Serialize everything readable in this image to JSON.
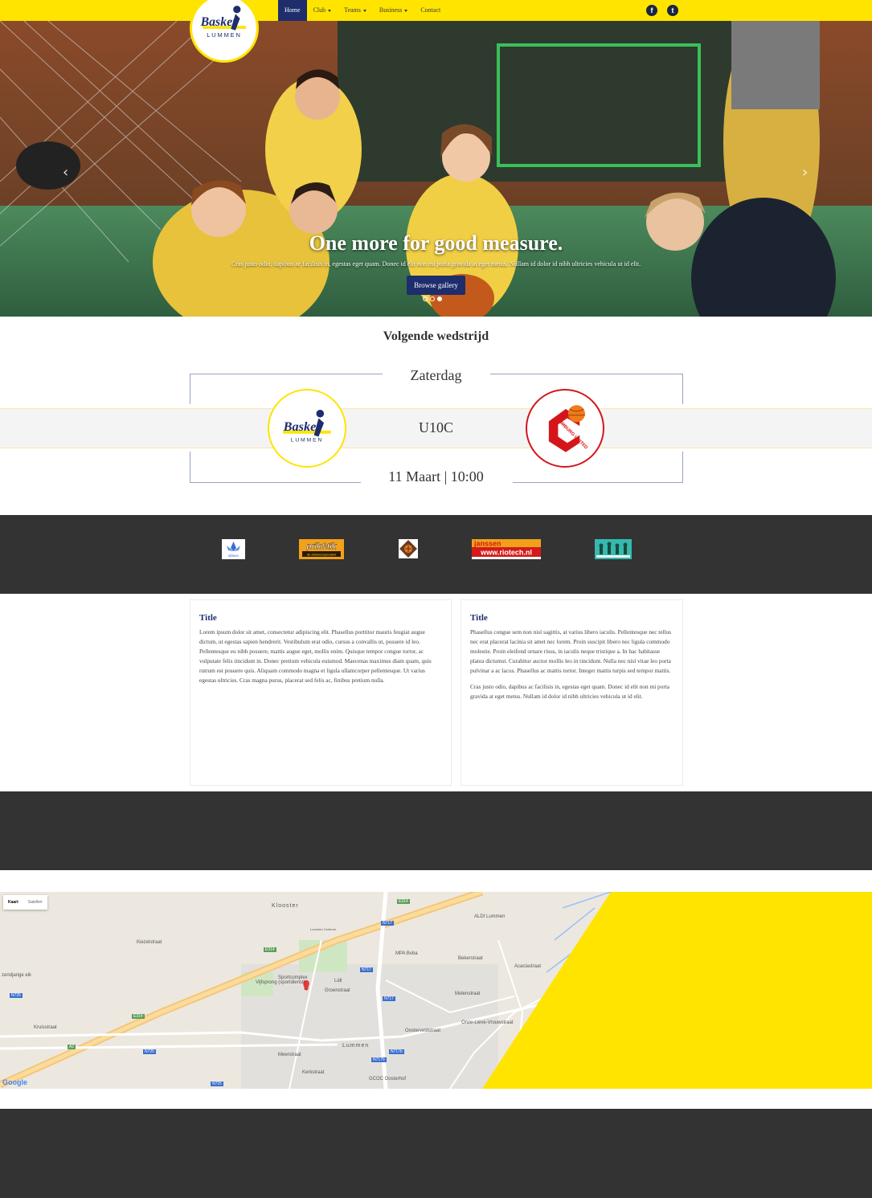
{
  "navbar": {
    "brand": {
      "line1": "Basket",
      "line2": "LUMMEN"
    },
    "items": [
      {
        "label": "Home",
        "active": true,
        "dropdown": false
      },
      {
        "label": "Club",
        "active": false,
        "dropdown": true
      },
      {
        "label": "Teams",
        "active": false,
        "dropdown": true
      },
      {
        "label": "Business",
        "active": false,
        "dropdown": true
      },
      {
        "label": "Contact",
        "active": false,
        "dropdown": false
      }
    ],
    "social": [
      {
        "icon": "facebook-icon",
        "glyph": "f"
      },
      {
        "icon": "twitter-icon",
        "glyph": "t"
      }
    ]
  },
  "hero": {
    "title": "One more for good measure.",
    "text": "Cras justo odio, dapibus ac facilisis in, egestas eget quam. Donec id elit non mi porta gravida at eget metus. Nullam id dolor id nibh ultricies vehicula ut id elit.",
    "button": "Browse gallery",
    "slides": 3,
    "active_slide": 3,
    "prev_icon": "chevron-left-icon",
    "next_icon": "chevron-right-icon"
  },
  "match": {
    "heading": "Volgende wedstrijd",
    "day": "Zaterdag",
    "team": "U10C",
    "datetime": "11 Maart | 10:00",
    "home": {
      "line1": "Basket",
      "line2": "LUMMEN"
    },
    "away": {
      "name": "LIMBURG UNITED"
    }
  },
  "sponsors": [
    {
      "name": "aliaion",
      "text": "aliaion"
    },
    {
      "name": "prik-en-tik",
      "text": "prik&tik",
      "sub": "de drankenspecialist"
    },
    {
      "name": "sponsor-3",
      "text": ""
    },
    {
      "name": "janssen-riotech",
      "text": "janssen",
      "sub": "www.riotech.nl"
    },
    {
      "name": "sponsor-5",
      "text": ""
    }
  ],
  "articles": [
    {
      "title": "Title",
      "paragraphs": [
        "Lorem ipsum dolor sit amet, consectetur adipiscing elit. Phasellus porttitor mauris feugiat augue dictum, ut egestas sapien hendrerit. Vestibulum erat odio, cursus a convallis ut, posuere id leo. Pellentesque eu nibh posuere, mattis augue eget, mollis enim. Quisque tempor congue tortor, ac vulputate felis tincidunt in. Donec pretium vehicula euismod. Maecenas maximus diam quam, quis rutrum est posuere quis. Aliquam commodo magna et ligula ullamcorper pellentesque. Ut varius egestas ultricies. Cras magna purus, placerat sed felis ac, finibus pretium nulla."
      ]
    },
    {
      "title": "Title",
      "paragraphs": [
        "Phasellus congue sem non nisl sagittis, at varius libero iaculis. Pellentesque nec tellus nec erat placerat lacinia sit amet nec lorem. Proin suscipit libero nec ligula commodo molestie. Proin eleifend ornare risus, in iaculis neque tristique a. In hac habitasse platea dictumst. Curabitur auctor mollis leo in tincidunt. Nulla nec nisl vitae leo porta pulvinar a ac lacus. Phasellus ac mattis tortor. Integer mattis turpis sed tempor mattis.",
        "Cras justo odio, dapibus ac facilisis in, egestas eget quam. Donec id elit non mi porta gravida at eget metus. Nullam id dolor id nibh ultricies vehicula ut id elit."
      ]
    }
  ],
  "map": {
    "toggle": {
      "map": "Kaart",
      "satellite": "Satelliet"
    },
    "labels": [
      "Klooster",
      "ALDI Lummen",
      "MPA Bvba",
      "Sportcomplex",
      "Vijfsprong (sportdienst)",
      "Lidl",
      "Lummen",
      "Lummen Centrum",
      "GCOC Oosterhof",
      "Kruisstraat",
      "zendjarige eik",
      "Onze-Lieve-Vrouwstraat",
      "Groenstraat",
      "Kerkstraat",
      "Meerstraat",
      "Oosterveldstraat",
      "Acaciastraat",
      "Molenstraat",
      "Bekerstraat",
      "Kiezelstraat"
    ],
    "roads": [
      "E314",
      "E314",
      "E314",
      "A2",
      "N717",
      "N717",
      "N717",
      "N717b",
      "N725",
      "N725",
      "N725",
      "N717b"
    ],
    "attribution": "Google",
    "accent": "#ffe400"
  },
  "colors": {
    "brand_yellow": "#ffe400",
    "brand_navy": "#1e2d6b",
    "dark": "#333333"
  }
}
